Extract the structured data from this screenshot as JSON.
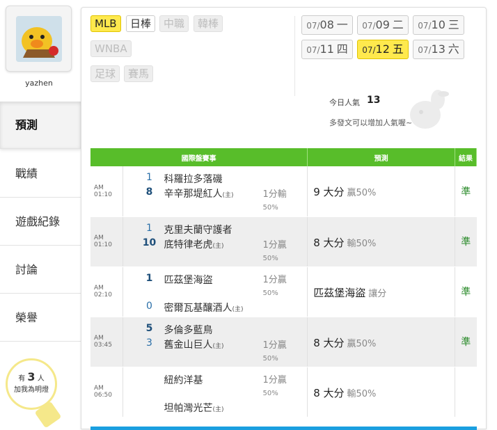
{
  "user": {
    "name": "yazhen"
  },
  "nav": [
    {
      "label": "預測",
      "active": true
    },
    {
      "label": "戰績"
    },
    {
      "label": "遊戲紀錄"
    },
    {
      "label": "討論"
    },
    {
      "label": "榮譽"
    }
  ],
  "likes": {
    "prefix": "有",
    "count": "3",
    "suffix": "人",
    "line2": "加我為明燈"
  },
  "sports_tabs": [
    {
      "label": "MLB",
      "state": "on"
    },
    {
      "label": "日棒",
      "state": "norm"
    },
    {
      "label": "中職",
      "state": "off"
    },
    {
      "label": "韓棒",
      "state": "off"
    },
    {
      "label": "WNBA",
      "state": "off"
    },
    {
      "label": "足球",
      "state": "off"
    },
    {
      "label": "賽馬",
      "state": "off"
    }
  ],
  "dates": [
    {
      "md": "07/",
      "day": "08",
      "wd": "一"
    },
    {
      "md": "07/",
      "day": "09",
      "wd": "二"
    },
    {
      "md": "07/",
      "day": "10",
      "wd": "三"
    },
    {
      "md": "07/",
      "day": "11",
      "wd": "四"
    },
    {
      "md": "07/",
      "day": "12",
      "wd": "五",
      "selected": true
    },
    {
      "md": "07/",
      "day": "13",
      "wd": "六"
    }
  ],
  "popularity": {
    "label": "今日人氣",
    "value": "13",
    "note": "多發文可以增加人氣喔~"
  },
  "table": {
    "headers": {
      "game": "國際盤賽事",
      "pred": "預測",
      "result": "結果"
    },
    "host_mark": "(主)",
    "rows": [
      {
        "time": "AM 01:10",
        "away": "科羅拉多落磯",
        "away_score": "1",
        "home": "辛辛那堤紅人",
        "home_score": "8",
        "line": "1分輸",
        "pct": "50",
        "pick": "9 大分",
        "odds": "贏50%",
        "result": "準"
      },
      {
        "time": "AM 01:10",
        "away": "克里夫蘭守護者",
        "away_score": "1",
        "home": "底特律老虎",
        "home_score": "10",
        "line": "1分贏",
        "pct": "50",
        "pick": "8 大分",
        "odds": "輸50%",
        "result": "準"
      },
      {
        "time": "AM 02:10",
        "away": "匹茲堡海盜",
        "away_score": "1",
        "home": "密爾瓦基釀酒人",
        "home_score": "0",
        "line": "1分贏",
        "pct": "50",
        "pick": "匹茲堡海盜",
        "odds": "讓分",
        "result": "準"
      },
      {
        "time": "AM 03:45",
        "away": "多倫多藍鳥",
        "away_score": "5",
        "home": "舊金山巨人",
        "home_score": "3",
        "line": "1分贏",
        "pct": "50",
        "pick": "8 大分",
        "odds": "贏50%",
        "result": "準"
      },
      {
        "time": "AM 06:50",
        "away": "紐約洋基",
        "away_score": "",
        "home": "坦帕灣光芒",
        "home_score": "",
        "line": "1分贏",
        "pct": "50",
        "pick": "8 大分",
        "odds": "輸50%",
        "result": ""
      }
    ]
  },
  "colors": {
    "accent": "#58bd2a",
    "highlight": "#ffe94d",
    "bar": "#1a9fe0"
  }
}
